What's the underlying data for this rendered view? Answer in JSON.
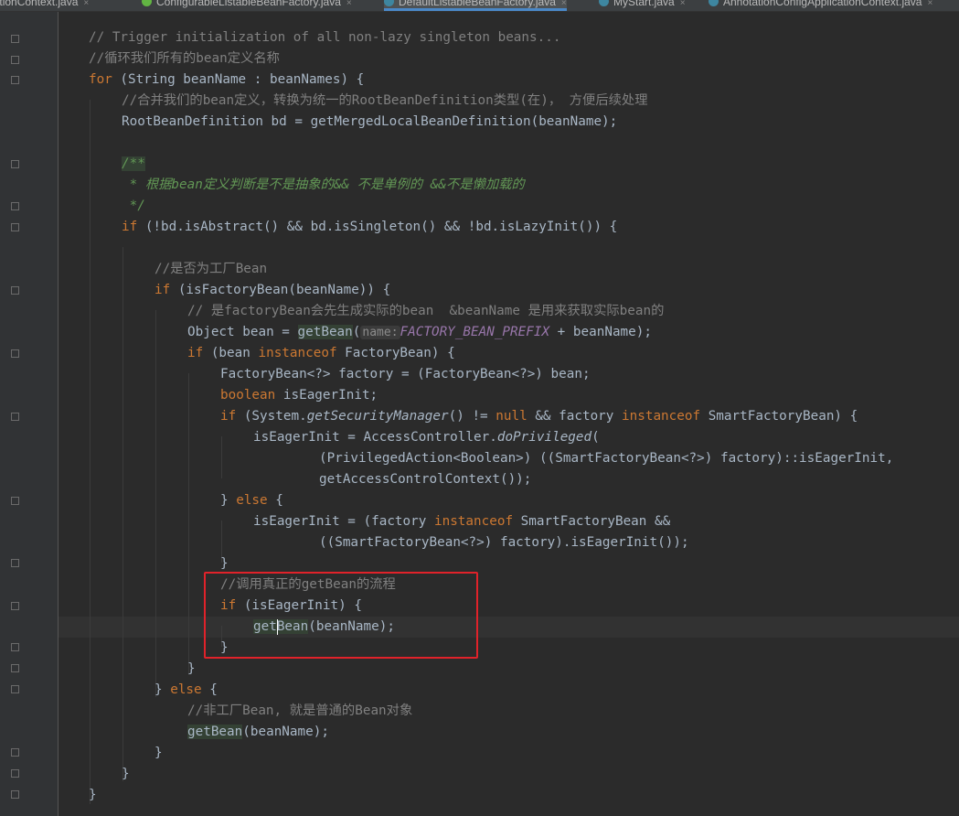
{
  "tabs": [
    {
      "label": "ApplicationContext.java",
      "active": false,
      "icon": "none"
    },
    {
      "label": "ConfigurableListableBeanFactory.java",
      "active": false,
      "icon": "interface-icon"
    },
    {
      "label": "DefaultListableBeanFactory.java",
      "active": true,
      "icon": "class-icon"
    },
    {
      "label": "MyStart.java",
      "active": false,
      "icon": "class-icon"
    },
    {
      "label": "AnnotationConfigApplicationContext.java",
      "active": false,
      "icon": "class-icon"
    }
  ],
  "colors": {
    "background": "#2b2b2b",
    "keyword": "#cc7832",
    "comment": "#808080",
    "doc_comment": "#629755",
    "constant": "#9876aa",
    "text": "#a9b7c6",
    "highlight_box": "#e0222a"
  },
  "code": {
    "l1": "// Trigger initialization of all non-lazy singleton beans...",
    "l2": "//循环我们所有的bean定义名称",
    "l3_kw": "for",
    "l3_rest": " (String beanName : beanNames) {",
    "l4": "//合并我们的bean定义，转换为统一的RootBeanDefinition类型(在)， 方便后续处理",
    "l5": "RootBeanDefinition bd = getMergedLocalBeanDefinition(beanName);",
    "l7": "/**",
    "l8": " * 根据bean定义判断是不是抽象的&& 不是单例的 &&不是懒加载的",
    "l9": " */",
    "l10_kw": "if",
    "l10_rest": " (!bd.isAbstract() && bd.isSingleton() && !bd.isLazyInit()) {",
    "l12": "//是否为工厂Bean",
    "l13_kw": "if",
    "l13_rest": " (isFactoryBean(beanName)) {",
    "l14": "// 是factoryBean会先生成实际的bean  &beanName 是用来获取实际bean的",
    "l15_a": "Object bean = ",
    "l15_call": "getBean",
    "l15_b": "(",
    "l15_hint": "name:",
    "l15_const": "FACTORY_BEAN_PREFIX",
    "l15_c": " + beanName);",
    "l16_kw": "if",
    "l16_a": " (bean ",
    "l16_kw2": "instanceof",
    "l16_b": " FactoryBean) {",
    "l17": "FactoryBean<?> factory = (FactoryBean<?>) bean;",
    "l18_kw": "boolean",
    "l18_rest": " isEagerInit;",
    "l19_kw": "if",
    "l19_a": " (System.",
    "l19_ital": "getSecurityManager",
    "l19_b": "() != ",
    "l19_null": "null",
    "l19_c": " && factory ",
    "l19_kw2": "instanceof",
    "l19_d": " SmartFactoryBean) {",
    "l20_a": "isEagerInit = AccessController.",
    "l20_ital": "doPrivileged",
    "l20_b": "(",
    "l21": "(PrivilegedAction<Boolean>) ((SmartFactoryBean<?>) factory)::isEagerInit,",
    "l22": "getAccessControlContext());",
    "l23_a": "} ",
    "l23_kw": "else",
    "l23_b": " {",
    "l24_a": "isEagerInit = (factory ",
    "l24_kw": "instanceof",
    "l24_b": " SmartFactoryBean &&",
    "l25": "((SmartFactoryBean<?>) factory).isEagerInit());",
    "l26": "}",
    "l27": "//调用真正的getBean的流程",
    "l28_kw": "if",
    "l28_rest": " (isEagerInit) {",
    "l29_a": "get",
    "l29_b": "Bean",
    "l29_c": "(beanName);",
    "l30": "}",
    "l31": "}",
    "l32_a": "} ",
    "l32_kw": "else",
    "l32_b": " {",
    "l33": "//非工厂Bean, 就是普通的Bean对象",
    "l34_call": "getBean",
    "l34_rest": "(beanName);",
    "l35": "}",
    "l36": "}",
    "l37": "}"
  }
}
